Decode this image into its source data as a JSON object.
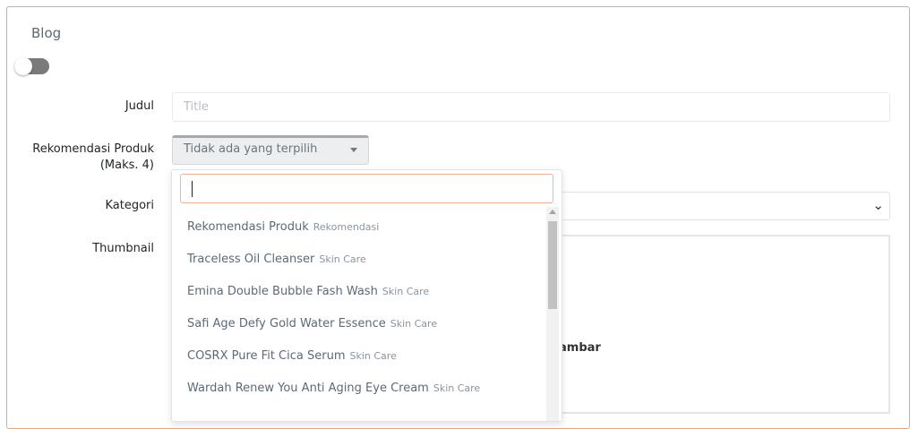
{
  "card": {
    "title": "Blog"
  },
  "form": {
    "title_label": "Judul",
    "title_placeholder": "Title",
    "products_label_line1": "Rekomendasi Produk",
    "products_label_line2": "(Maks. 4)",
    "products_selected": "Tidak ada yang terpilih",
    "category_label": "Kategori",
    "thumbnail_label": "Thumbnail",
    "thumbnail_text": "ambar"
  },
  "dropdown": {
    "items": [
      {
        "name": "Rekomendasi Produk",
        "category": "Rekomendasi"
      },
      {
        "name": "Traceless Oil Cleanser",
        "category": "Skin Care"
      },
      {
        "name": "Emina Double Bubble Fash Wash",
        "category": "Skin Care"
      },
      {
        "name": "Safi Age Defy Gold Water Essence",
        "category": "Skin Care"
      },
      {
        "name": "COSRX Pure Fit Cica Serum",
        "category": "Skin Care"
      },
      {
        "name": "Wardah Renew You Anti Aging Eye Cream",
        "category": "Skin Care"
      }
    ]
  },
  "colors": {
    "accent_border": "#f0a27a",
    "toggle_off": "#7a7a7a"
  },
  "toggle": {
    "state": "off"
  }
}
